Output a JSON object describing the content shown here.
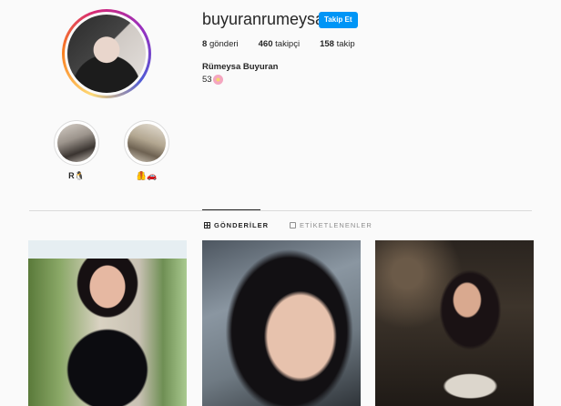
{
  "profile": {
    "username": "buyuranrumeysa",
    "follow_label": "Takip Et",
    "full_name": "Rümeysa Buyuran",
    "bio": "53",
    "stats": {
      "posts_count": "8",
      "posts_label": "gönderi",
      "followers_count": "460",
      "followers_label": "takipçi",
      "following_count": "158",
      "following_label": "takip"
    }
  },
  "highlights": [
    {
      "label": "R🐧"
    },
    {
      "label": "🦺🚗"
    }
  ],
  "tabs": {
    "posts": "GÖNDERİLER",
    "tagged": "ETİKETLENENLER"
  },
  "colors": {
    "accent": "#0095f6",
    "text": "#262626",
    "muted": "#8e8e8e",
    "border": "#dbdbdb",
    "background": "#fafafa"
  },
  "icons": {
    "posts_tab": "grid-icon",
    "tagged_tab": "tag-icon",
    "bio_emoji": "flower-icon"
  }
}
